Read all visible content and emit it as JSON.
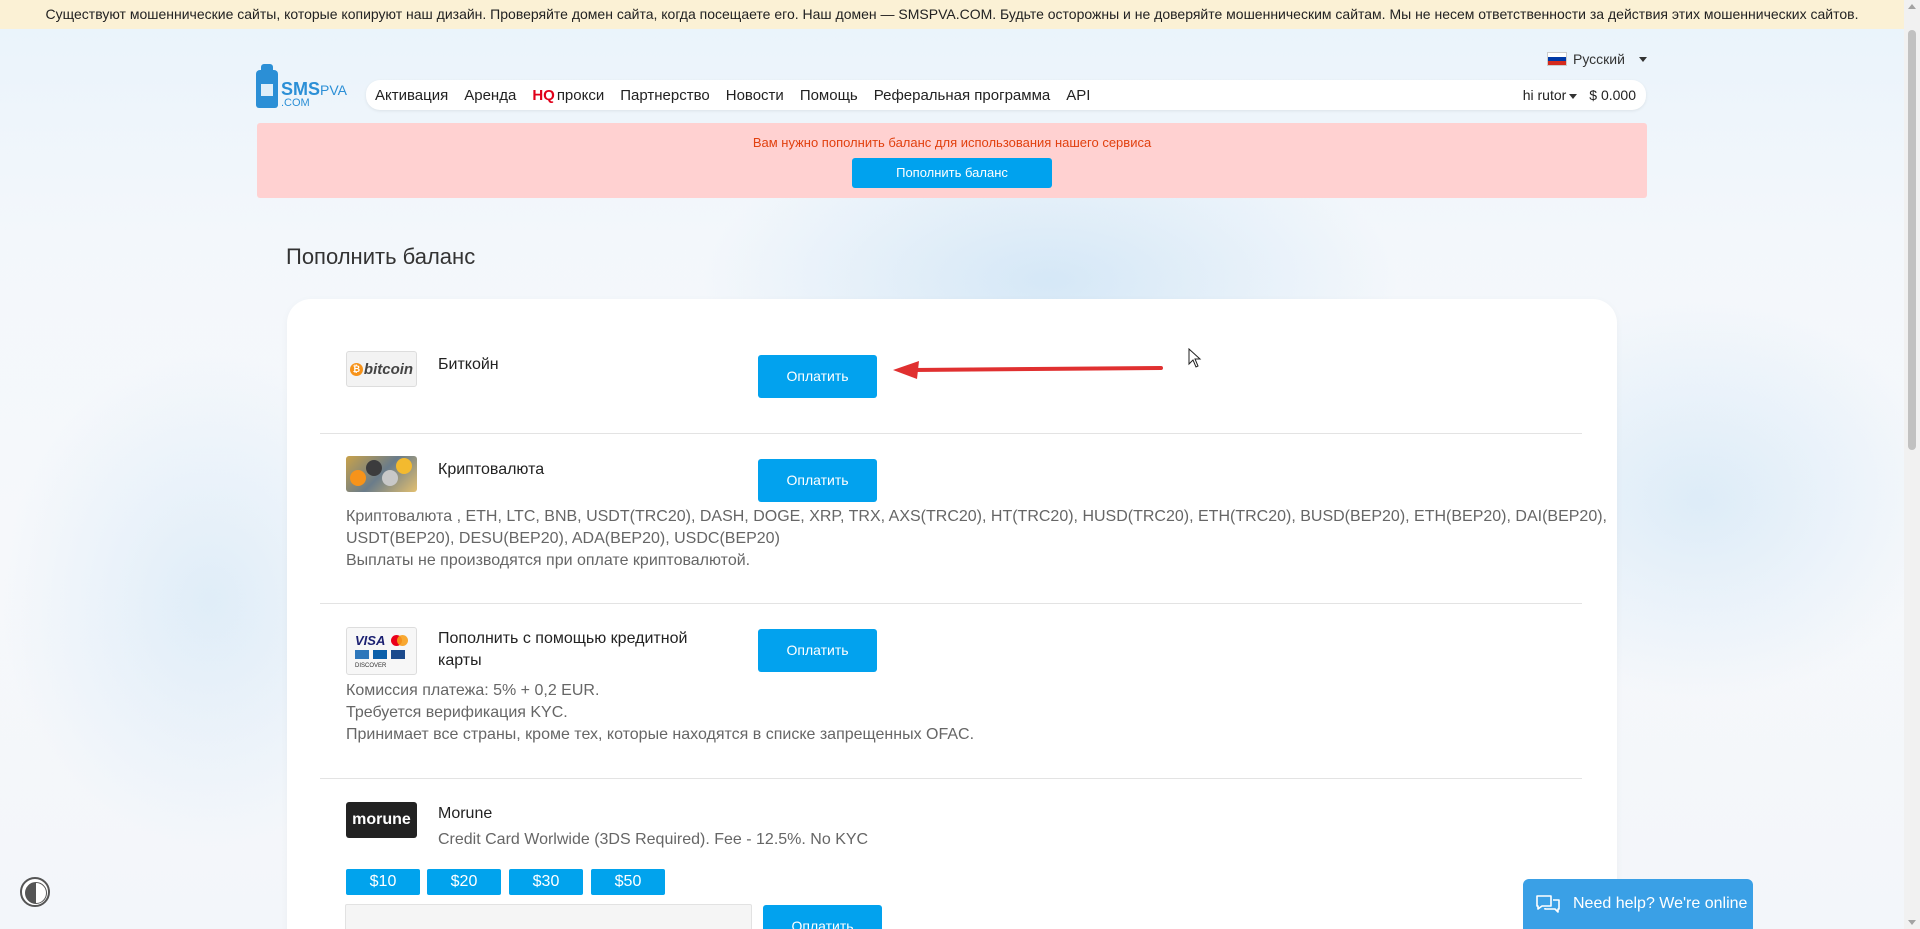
{
  "warning": "Существуют мошеннические сайты, которые копируют наш дизайн. Проверяйте домен сайта, когда посещаете его. Наш домен — SMSPVA.COM. Будьте осторожны и не доверяйте мошенническим сайтам. Мы не несем ответственности за действия этих мошеннических сайтов.",
  "language": "Русский",
  "logo": {
    "main": "SMS",
    "pva": "PVA",
    "com": ".COM"
  },
  "nav": {
    "items": [
      "Активация",
      "Аренда",
      "прокси",
      "Партнерство",
      "Новости",
      "Помощь",
      "Реферальная программа",
      "API"
    ],
    "hq": "HQ",
    "user": "hi rutor",
    "balance": "$ 0.000"
  },
  "alert": {
    "text": "Вам нужно пополнить баланс для использования нашего сервиса",
    "button": "Пополнить баланс"
  },
  "page_title": "Пополнить баланс",
  "methods": {
    "bitcoin": {
      "icon": "bitcoin",
      "name": "Биткойн",
      "button": "Оплатить"
    },
    "crypto": {
      "name": "Криптовалюта",
      "button": "Оплатить",
      "desc1": "Криптовалюта , ETH, LTC, BNB, USDT(TRC20), DASH, DOGE, XRP, TRX, AXS(TRC20), HT(TRC20), HUSD(TRC20), ETH(TRC20), BUSD(BEP20), ETH(BEP20), DAI(BEP20),",
      "desc2": "USDT(BEP20), DESU(BEP20), ADA(BEP20), USDC(BEP20)",
      "desc3": "Выплаты не производятся при оплате криптовалютой."
    },
    "card": {
      "name1": "Пополнить с помощью кредитной",
      "name2": "карты",
      "button": "Оплатить",
      "desc1": "Комиссия платежа: 5% + 0,2 EUR.",
      "desc2": "Требуется верификация KYC.",
      "desc3": "Принимает все страны, кроме тех, которые находятся в списке запрещенных OFAC.",
      "icon_visa": "VISA",
      "icon_discover": "DISCOVER"
    },
    "morune": {
      "icon": "morune",
      "name": "Morune",
      "desc": "Credit Card Worlwide (3DS Required). Fee - 12.5%. No KYC",
      "amounts": [
        "$10",
        "$20",
        "$30",
        "$50"
      ],
      "button": "Оплатить"
    }
  },
  "help_chat": "Need help? We're online",
  "colors": {
    "accent": "#02a2ee",
    "alert_bg": "#ffd1d1",
    "alert_text": "#e1400f",
    "warning_bg": "#fbf1d5",
    "arrow": "#e03030"
  }
}
